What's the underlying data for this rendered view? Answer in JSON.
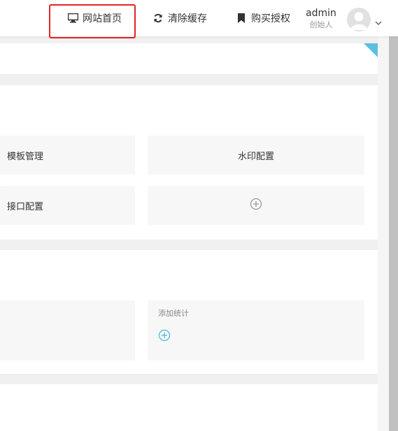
{
  "header": {
    "nav": [
      {
        "label": "网站首页",
        "icon": "monitor-icon"
      },
      {
        "label": "清除缓存",
        "icon": "refresh-icon"
      },
      {
        "label": "购买授权",
        "icon": "bookmark-icon"
      }
    ],
    "user": {
      "name": "admin",
      "role": "创始人"
    }
  },
  "tiles": {
    "template": "模板管理",
    "watermark": "水印配置",
    "api": "接口配置"
  },
  "stats": {
    "add_label": "添加统计"
  },
  "colors": {
    "highlight": "#e12424",
    "accent": "#5bc0de",
    "tile_bg": "#f7f7f7"
  }
}
